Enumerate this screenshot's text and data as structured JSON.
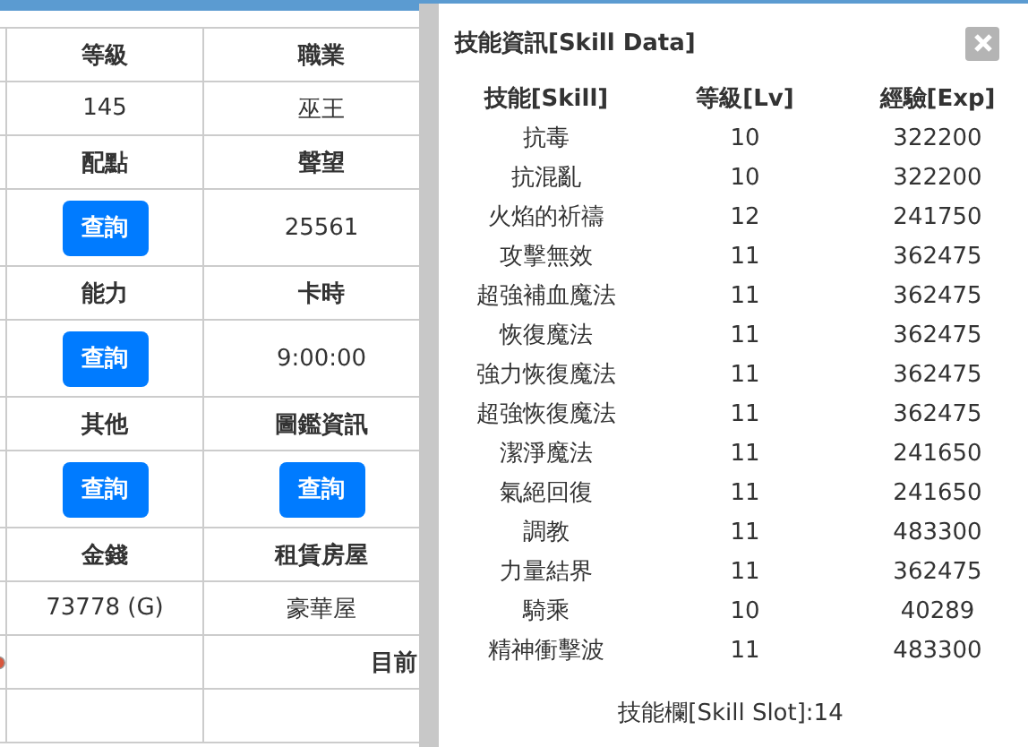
{
  "info_table": {
    "rows": [
      {
        "cells": [
          {
            "kind": "header",
            "text": "等級"
          },
          {
            "kind": "header",
            "text": "職業"
          }
        ]
      },
      {
        "cells": [
          {
            "kind": "text",
            "text": "145"
          },
          {
            "kind": "text",
            "text": "巫王"
          }
        ]
      },
      {
        "cells": [
          {
            "kind": "header",
            "text": "配點"
          },
          {
            "kind": "header",
            "text": "聲望"
          }
        ]
      },
      {
        "cells": [
          {
            "kind": "button",
            "text": "查詢"
          },
          {
            "kind": "text",
            "text": "25561"
          }
        ]
      },
      {
        "cells": [
          {
            "kind": "header",
            "text": "能力"
          },
          {
            "kind": "header",
            "text": "卡時"
          }
        ]
      },
      {
        "cells": [
          {
            "kind": "button",
            "text": "查詢"
          },
          {
            "kind": "text",
            "text": "9:00:00"
          }
        ]
      },
      {
        "cells": [
          {
            "kind": "header",
            "text": "其他"
          },
          {
            "kind": "header",
            "text": "圖鑑資訊"
          }
        ]
      },
      {
        "cells": [
          {
            "kind": "button",
            "text": "查詢"
          },
          {
            "kind": "button",
            "text": "查詢"
          }
        ]
      },
      {
        "cells": [
          {
            "kind": "header",
            "text": "金錢"
          },
          {
            "kind": "header",
            "text": "租賃房屋"
          }
        ]
      },
      {
        "cells": [
          {
            "kind": "text",
            "text": "73778 (G)"
          },
          {
            "kind": "text",
            "text": "豪華屋"
          }
        ]
      },
      {
        "cells": [
          {
            "kind": "icon"
          },
          {
            "kind": "header-right",
            "text": "目前"
          }
        ]
      },
      {
        "cells": [
          {
            "kind": "empty"
          },
          {
            "kind": "empty"
          }
        ]
      }
    ]
  },
  "skill_dialog": {
    "title": "技能資訊[Skill Data]",
    "columns": [
      "技能[Skill]",
      "等級[Lv]",
      "經驗[Exp]"
    ],
    "rows": [
      {
        "skill": "抗毒",
        "level": "10",
        "exp": "322200"
      },
      {
        "skill": "抗混亂",
        "level": "10",
        "exp": "322200"
      },
      {
        "skill": "火焰的祈禱",
        "level": "12",
        "exp": "241750"
      },
      {
        "skill": "攻擊無效",
        "level": "11",
        "exp": "362475"
      },
      {
        "skill": "超強補血魔法",
        "level": "11",
        "exp": "362475"
      },
      {
        "skill": "恢復魔法",
        "level": "11",
        "exp": "362475"
      },
      {
        "skill": "強力恢復魔法",
        "level": "11",
        "exp": "362475"
      },
      {
        "skill": "超強恢復魔法",
        "level": "11",
        "exp": "362475"
      },
      {
        "skill": "潔淨魔法",
        "level": "11",
        "exp": "241650"
      },
      {
        "skill": "氣絕回復",
        "level": "11",
        "exp": "241650"
      },
      {
        "skill": "調教",
        "level": "11",
        "exp": "483300"
      },
      {
        "skill": "力量結界",
        "level": "11",
        "exp": "362475"
      },
      {
        "skill": "騎乘",
        "level": "10",
        "exp": "40289"
      },
      {
        "skill": "精神衝擊波",
        "level": "11",
        "exp": "483300"
      }
    ],
    "footer": "技能欄[Skill Slot]:14"
  }
}
